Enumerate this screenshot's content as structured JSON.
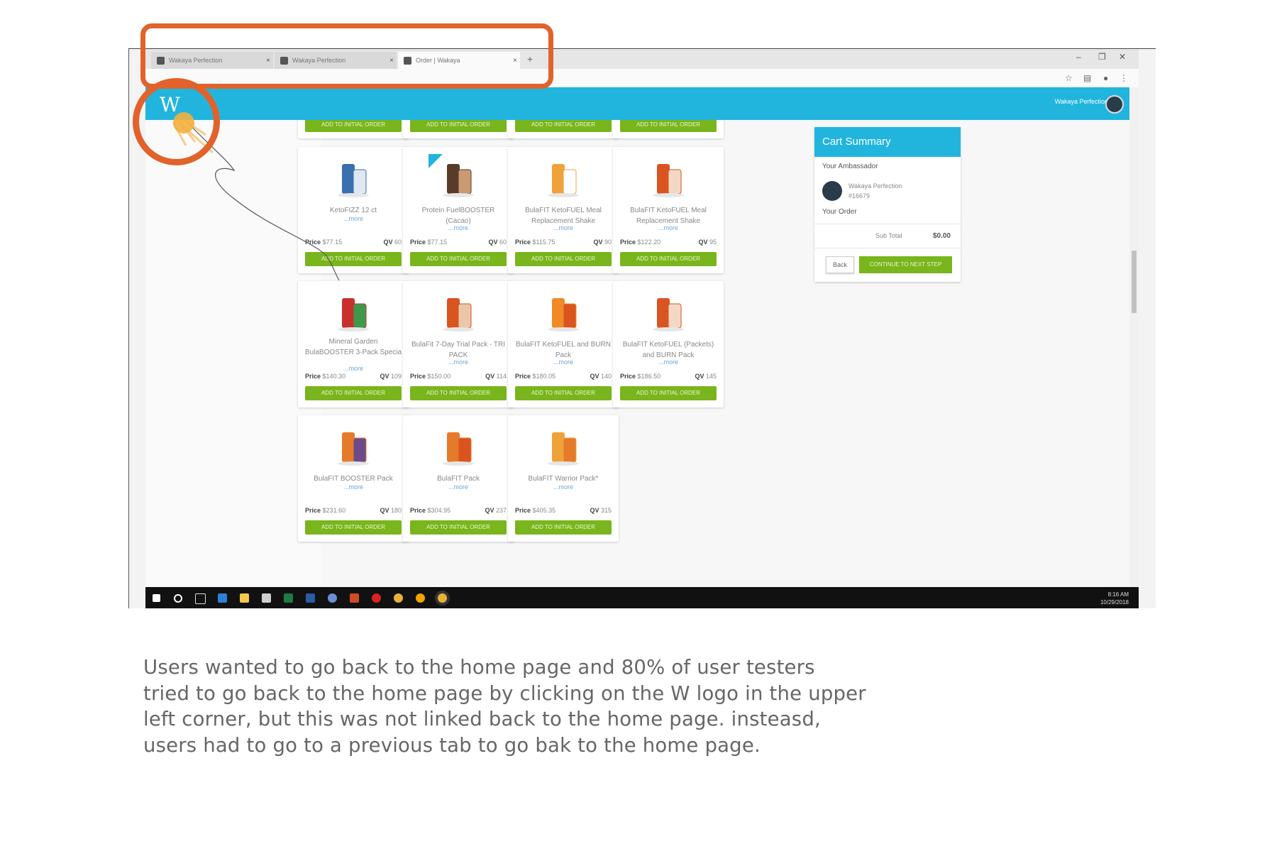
{
  "browser": {
    "tabs": [
      {
        "title": "Wakaya Perfection"
      },
      {
        "title": "Wakaya Perfection"
      },
      {
        "title": "Order | Wakaya"
      }
    ]
  },
  "header": {
    "logo": "W",
    "user_name": "Wakaya Perfection"
  },
  "top_row_button_label": "ADD TO INITIAL ORDER",
  "products": [
    {
      "name": "KetoFIZZ 12 ct",
      "more": "...more",
      "price_label": "Price",
      "price": "$77.15",
      "qv_label": "QV",
      "qv": "60",
      "button": "ADD TO INITIAL ORDER"
    },
    {
      "name": "Protein FuelBOOSTER (Cacao)",
      "more": "...more",
      "price_label": "Price",
      "price": "$77.15",
      "qv_label": "QV",
      "qv": "60",
      "button": "ADD TO INITIAL ORDER"
    },
    {
      "name": "BulaFIT KetoFUEL Meal Replacement Shake",
      "more": "...more",
      "price_label": "Price",
      "price": "$115.75",
      "qv_label": "QV",
      "qv": "90",
      "button": "ADD TO INITIAL ORDER"
    },
    {
      "name": "BulaFIT KetoFUEL Meal Replacement Shake",
      "more": "...more",
      "price_label": "Price",
      "price": "$122.20",
      "qv_label": "QV",
      "qv": "95",
      "button": "ADD TO INITIAL ORDER"
    },
    {
      "name": "Mineral Garden BulaBOOSTER 3-Pack Specia",
      "more": "...more",
      "price_label": "Price",
      "price": "$140.30",
      "qv_label": "QV",
      "qv": "109",
      "button": "ADD TO INITIAL ORDER"
    },
    {
      "name": "BulaFit 7-Day Trial Pack - TRI PACK",
      "more": "...more",
      "price_label": "Price",
      "price": "$150.00",
      "qv_label": "QV",
      "qv": "114",
      "button": "ADD TO INITIAL ORDER"
    },
    {
      "name": "BulaFIT KetoFUEL and BURN Pack",
      "more": "...more",
      "price_label": "Price",
      "price": "$180.05",
      "qv_label": "QV",
      "qv": "140",
      "button": "ADD TO INITIAL ORDER"
    },
    {
      "name": "BulaFIT KetoFUEL (Packets) and BURN Pack",
      "more": "...more",
      "price_label": "Price",
      "price": "$186.50",
      "qv_label": "QV",
      "qv": "145",
      "button": "ADD TO INITIAL ORDER"
    },
    {
      "name": "BulaFIT BOOSTER Pack",
      "more": "...more",
      "price_label": "Price",
      "price": "$231.60",
      "qv_label": "QV",
      "qv": "180",
      "button": "ADD TO INITIAL ORDER"
    },
    {
      "name": "BulaFIT Pack",
      "more": "...more",
      "price_label": "Price",
      "price": "$304.95",
      "qv_label": "QV",
      "qv": "237",
      "button": "ADD TO INITIAL ORDER"
    },
    {
      "name": "BulaFIT Warrior Pack*",
      "more": "...more",
      "price_label": "Price",
      "price": "$405.35",
      "qv_label": "QV",
      "qv": "315",
      "button": "ADD TO INITIAL ORDER"
    }
  ],
  "cart": {
    "title": "Cart Summary",
    "ambassador_label": "Your Ambassador",
    "ambassador_name": "Wakaya Perfection",
    "ambassador_id": "#16679",
    "order_label": "Your Order",
    "subtotal_label": "Sub Total",
    "subtotal_value": "$0.00",
    "back_label": "Back",
    "continue_label": "CONTINUE TO NEXT STEP"
  },
  "taskbar": {
    "time": "8:16 AM",
    "date": "10/29/2018"
  },
  "colors": {
    "header": "#21b5de",
    "button_green": "#79b51c",
    "highlight": "#e2622b"
  },
  "caption": "Users wanted to go back to the home page and 80% of user testers tried to go back to the home page by clicking on the W logo in the upper left corner, but this was not linked back to the home page. insteasd, users had to go to a previous tab to go bak to the home page."
}
